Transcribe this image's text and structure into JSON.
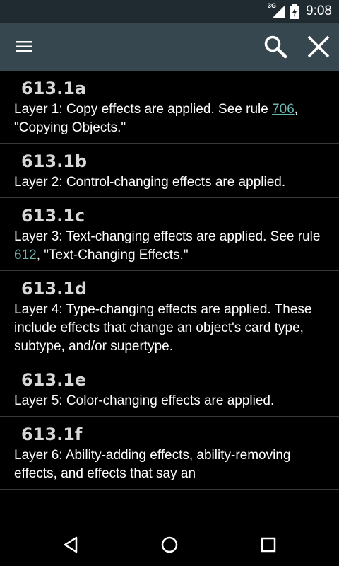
{
  "status": {
    "network": "3G",
    "time": "9:08"
  },
  "toolbar": {
    "menu_icon": "menu-icon",
    "search_icon": "search-icon",
    "close_icon": "close-icon"
  },
  "rules": [
    {
      "id": "613.1a",
      "text_before": "Layer 1: Copy effects are applied. See rule ",
      "link": "706",
      "text_after": ", \"Copying Objects.\""
    },
    {
      "id": "613.1b",
      "text_before": "Layer 2: Control-changing effects are applied.",
      "link": "",
      "text_after": ""
    },
    {
      "id": "613.1c",
      "text_before": "Layer 3: Text-changing effects are applied. See rule ",
      "link": "612",
      "text_after": ", \"Text-Changing Effects.\""
    },
    {
      "id": "613.1d",
      "text_before": "Layer 4: Type-changing effects are applied. These include effects that change an object's card type, subtype, and/or supertype.",
      "link": "",
      "text_after": ""
    },
    {
      "id": "613.1e",
      "text_before": "Layer 5: Color-changing effects are applied.",
      "link": "",
      "text_after": ""
    },
    {
      "id": "613.1f",
      "text_before": "Layer 6: Ability-adding effects, ability-removing effects, and effects that say an",
      "link": "",
      "text_after": ""
    }
  ],
  "nav": {
    "back_icon": "back-icon",
    "home_icon": "home-icon",
    "recents_icon": "recents-icon"
  },
  "colors": {
    "status_bar": "#1f2b30",
    "app_bar": "#37474f",
    "link": "#6ab5ae",
    "background": "#000000"
  }
}
